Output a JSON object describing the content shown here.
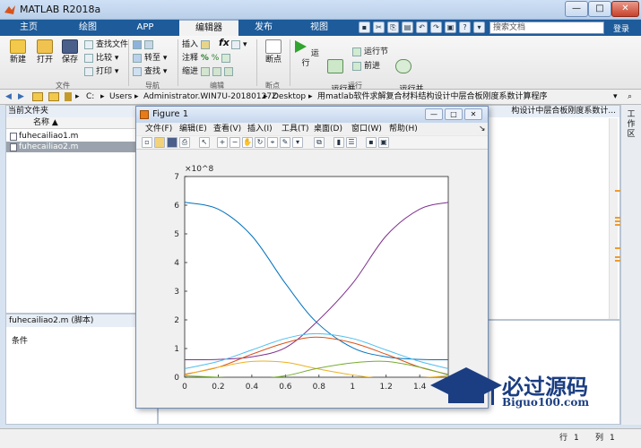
{
  "window": {
    "title": "MATLAB R2018a",
    "min": "—",
    "max": "□",
    "close": "✕"
  },
  "tabs": [
    {
      "label": "主页"
    },
    {
      "label": "绘图"
    },
    {
      "label": "APP"
    },
    {
      "label": "编辑器"
    },
    {
      "label": "发布"
    },
    {
      "label": "视图"
    }
  ],
  "search": {
    "placeholder": "搜索文档",
    "login": "登录"
  },
  "ribbon": {
    "new": "新建",
    "open": "打开",
    "save": "保存",
    "find_files": "查找文件",
    "compare": "比较",
    "print": "打印",
    "group_file": "文件",
    "goto": "转至",
    "find": "查找",
    "group_nav": "导航",
    "insert": "插入",
    "comment": "注释",
    "indent": "缩进",
    "fx": "fx",
    "group_edit": "编辑",
    "breakpoints": "断点",
    "group_bp": "断点",
    "run": "运行",
    "run_advance": "运行并\n前进",
    "run_section": "运行节",
    "advance": "前进",
    "run_time": "运行并\n计时",
    "group_run": "运行"
  },
  "address": {
    "c": "C:",
    "users": "Users",
    "admin": "Administrator.WIN7U-20180127Z",
    "desktop": "Desktop",
    "folder": "用matlab软件求解复合材料结构设计中层合板刚度系数计算程序"
  },
  "left_panel": {
    "title": "当前文件夹",
    "name_col": "名称 ▲",
    "files": [
      {
        "name": "fuhecailiao1.m"
      },
      {
        "name": "fuhecailiao2.m"
      }
    ]
  },
  "details": {
    "title": "fuhecailiao2.m  (脚本)",
    "body": "条件"
  },
  "editor": {
    "title_tail": "构设计中层合板刚度系数计..."
  },
  "right_strip": {
    "label": "工作区"
  },
  "status": {
    "row_label": "行",
    "row": "1",
    "col_label": "列",
    "col": "1"
  },
  "figure": {
    "title": "Figure 1",
    "menus": [
      "文件(F)",
      "编辑(E)",
      "查看(V)",
      "插入(I)",
      "工具(T)",
      "桌面(D)",
      "窗口(W)",
      "帮助(H)"
    ]
  },
  "watermark": {
    "text": "必过源码",
    "url": "Biguo100.com"
  },
  "chart_data": {
    "type": "line",
    "xlim": [
      0,
      1.57
    ],
    "ylim": [
      0,
      7
    ],
    "xticks": [
      "0",
      "0.2",
      "0.4",
      "0.6",
      "0.8",
      "1",
      "1.2",
      "1.4"
    ],
    "yticks": [
      "0",
      "1",
      "2",
      "3",
      "4",
      "5",
      "6",
      "7"
    ],
    "y_exponent": "×10^8",
    "grid": false,
    "series": [
      {
        "color": "#0072BD",
        "x": [
          0,
          0.2,
          0.4,
          0.6,
          0.785,
          1.0,
          1.2,
          1.4,
          1.57
        ],
        "y": [
          6.1,
          5.86,
          4.93,
          3.27,
          1.92,
          1.03,
          0.71,
          0.62,
          0.61
        ]
      },
      {
        "color": "#7E2F8E",
        "x": [
          0,
          0.2,
          0.4,
          0.6,
          0.785,
          1.0,
          1.2,
          1.4,
          1.57
        ],
        "y": [
          0.61,
          0.62,
          0.71,
          1.03,
          1.92,
          3.27,
          4.93,
          5.86,
          6.1
        ]
      },
      {
        "color": "#4DBEEE",
        "x": [
          0,
          0.2,
          0.4,
          0.6,
          0.785,
          1.0,
          1.2,
          1.4,
          1.57
        ],
        "y": [
          0.3,
          0.55,
          0.95,
          1.35,
          1.52,
          1.35,
          0.95,
          0.55,
          0.3
        ]
      },
      {
        "color": "#D95319",
        "x": [
          0,
          0.2,
          0.4,
          0.6,
          0.785,
          1.0,
          1.2,
          1.4,
          1.57
        ],
        "y": [
          0.1,
          0.35,
          0.8,
          1.2,
          1.4,
          1.2,
          0.8,
          0.35,
          0.1
        ]
      },
      {
        "color": "#EDB120",
        "x": [
          0,
          0.2,
          0.4,
          0.6,
          0.785,
          1.0,
          1.2,
          1.4,
          1.57
        ],
        "y": [
          0.08,
          0.35,
          0.55,
          0.52,
          0.3,
          0.08,
          -0.05,
          -0.02,
          0.05
        ]
      },
      {
        "color": "#77AC30",
        "x": [
          0,
          0.2,
          0.4,
          0.6,
          0.785,
          1.0,
          1.2,
          1.4,
          1.57
        ],
        "y": [
          0.05,
          0.0,
          -0.05,
          0.05,
          0.3,
          0.5,
          0.55,
          0.35,
          0.08
        ]
      }
    ]
  }
}
